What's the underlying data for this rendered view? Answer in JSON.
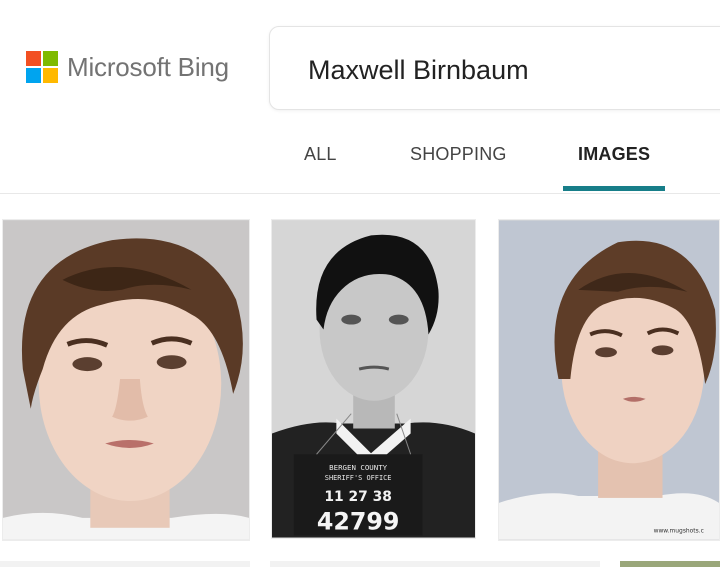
{
  "logo": {
    "text": "Microsoft Bing",
    "colors": [
      "#f25022",
      "#7fba00",
      "#00a4ef",
      "#ffb900"
    ]
  },
  "search": {
    "query": "Maxwell Birnbaum"
  },
  "tabs": [
    {
      "label": "ALL",
      "active": false
    },
    {
      "label": "SHOPPING",
      "active": false
    },
    {
      "label": "IMAGES",
      "active": true
    }
  ],
  "accent_color": "#177e89",
  "mugshot_placard": {
    "line1": "BERGEN COUNTY",
    "line2": "SHERIFF'S OFFICE",
    "date": "11  27  38",
    "number": "42799"
  },
  "results": [
    {
      "description": "mugshot-photo"
    },
    {
      "description": "black-and-white-mugshot"
    },
    {
      "description": "mugshot-photo",
      "watermark": "www.mugshots.c"
    }
  ]
}
